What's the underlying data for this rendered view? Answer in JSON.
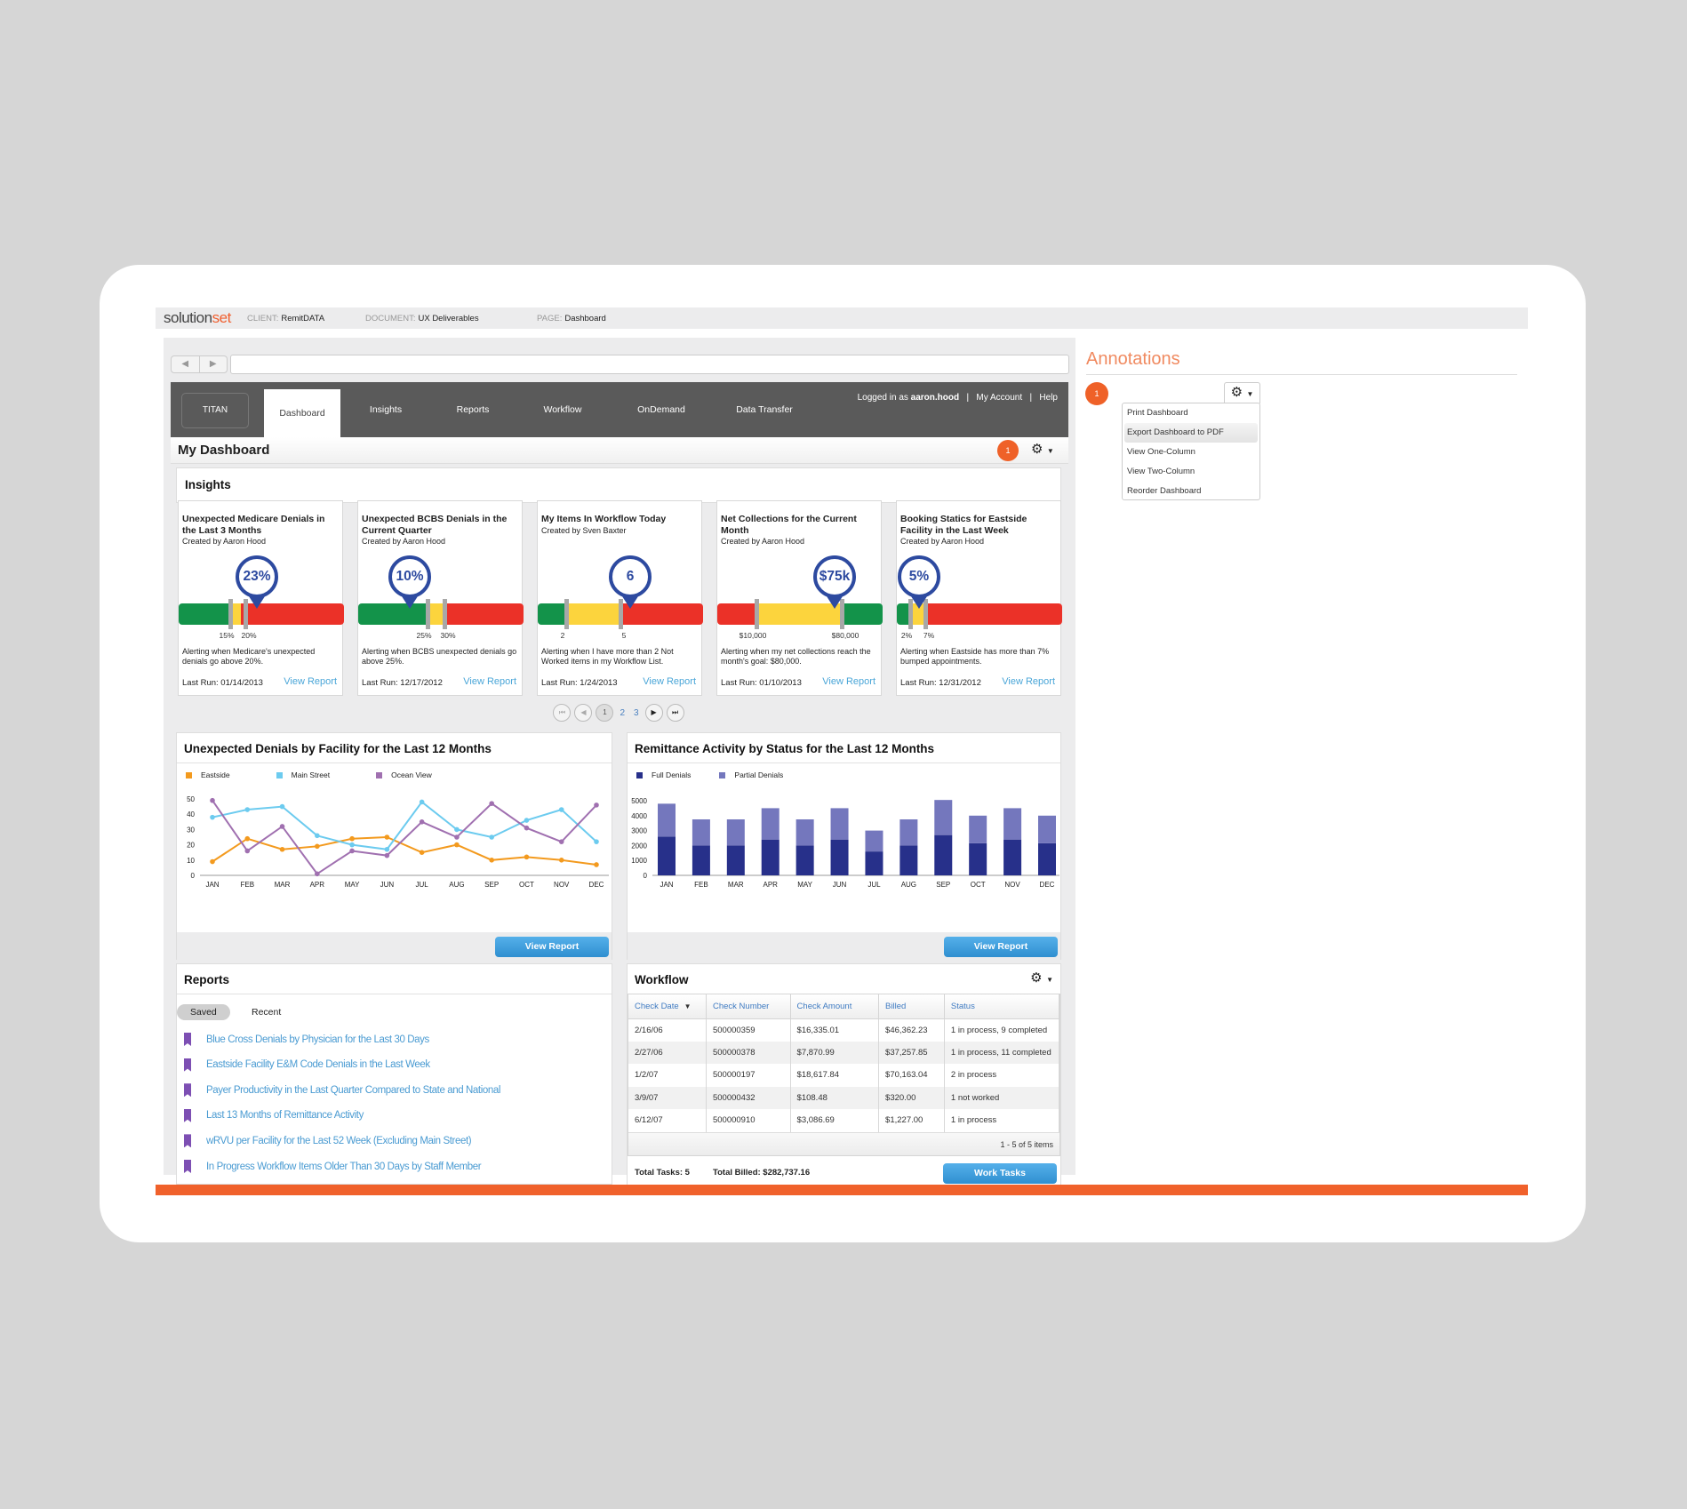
{
  "docbar": {
    "logo_a": "solution",
    "logo_b": "set",
    "client_label": "CLIENT:",
    "client": "RemitDATA",
    "document_label": "DOCUMENT:",
    "document": "UX Deliverables",
    "page_label": "PAGE:",
    "page": "Dashboard"
  },
  "nav": {
    "brand": "TITAN",
    "tabs": [
      "Dashboard",
      "Insights",
      "Reports",
      "Workflow",
      "OnDemand",
      "Data Transfer"
    ],
    "active": "Dashboard",
    "logged_in_prefix": "Logged in as",
    "user": "aaron.hood",
    "my_account": "My Account",
    "help": "Help",
    "sep": "|"
  },
  "dashboard": {
    "title": "My Dashboard",
    "annotation_badge": "1",
    "gear": "gear-icon"
  },
  "insights": {
    "title": "Insights",
    "cards": [
      {
        "title": "Unexpected Medicare Denials in the Last 3 Months",
        "creator": "Created by Aaron Hood",
        "value": "23%",
        "ticks": [
          "15%",
          "20%"
        ],
        "desc": "Alerting when Medicare's unexpected denials go above 20%.",
        "last_run": "Last Run: 01/14/2013",
        "link": "View Report"
      },
      {
        "title": "Unexpected BCBS Denials in the Current Quarter",
        "creator": "Created by Aaron Hood",
        "value": "10%",
        "ticks": [
          "25%",
          "30%"
        ],
        "desc": "Alerting when BCBS unexpected denials go above 25%.",
        "last_run": "Last Run: 12/17/2012",
        "link": "View Report"
      },
      {
        "title": "My Items In Workflow Today",
        "creator": "Created by Sven Baxter",
        "value": "6",
        "ticks": [
          "2",
          "5"
        ],
        "desc": "Alerting when I have more than 2 Not Worked items in my Workflow List.",
        "last_run": "Last Run: 1/24/2013",
        "link": "View Report"
      },
      {
        "title": "Net Collections for the Current Month",
        "creator": "Created by Aaron Hood",
        "value": "$75k",
        "ticks": [
          "$10,000",
          "$80,000"
        ],
        "desc": "Alerting when my net collections reach the month's goal: $80,000.",
        "last_run": "Last Run: 01/10/2013",
        "link": "View Report"
      },
      {
        "title": "Booking Statics for Eastside Facility in the Last Week",
        "creator": "Created by Aaron Hood",
        "value": "5%",
        "ticks": [
          "2%",
          "7%"
        ],
        "desc": "Alerting when Eastside has more than 7% bumped appointments.",
        "last_run": "Last Run: 12/31/2012",
        "link": "View Report"
      }
    ],
    "pager": {
      "current": "1",
      "pages": [
        "2",
        "3"
      ]
    }
  },
  "chart_data": [
    {
      "type": "line",
      "title": "Unexpected Denials by Facility for the Last 12 Months",
      "categories": [
        "JAN",
        "FEB",
        "MAR",
        "APR",
        "MAY",
        "JUN",
        "JUL",
        "AUG",
        "SEP",
        "OCT",
        "NOV",
        "DEC"
      ],
      "series": [
        {
          "name": "Eastside",
          "color": "#f39a1e",
          "values": [
            9,
            24,
            17,
            19,
            24,
            25,
            15,
            20,
            10,
            12,
            10,
            7
          ]
        },
        {
          "name": "Main Street",
          "color": "#6ccbef",
          "values": [
            38,
            43,
            45,
            26,
            20,
            17,
            48,
            30,
            25,
            36,
            43,
            22
          ]
        },
        {
          "name": "Ocean View",
          "color": "#a070b0",
          "values": [
            49,
            16,
            32,
            1,
            16,
            13,
            35,
            25,
            47,
            31,
            22,
            46
          ]
        }
      ],
      "yticks": [
        0,
        10,
        20,
        30,
        40,
        50
      ],
      "ylim": [
        0,
        50
      ],
      "legend": "top-left",
      "button": "View Report"
    },
    {
      "type": "bar",
      "stacked": true,
      "title": "Remittance Activity by Status for the Last 12 Months",
      "categories": [
        "JAN",
        "FEB",
        "MAR",
        "APR",
        "MAY",
        "JUN",
        "JUL",
        "AUG",
        "SEP",
        "OCT",
        "NOV",
        "DEC"
      ],
      "series": [
        {
          "name": "Full Denials",
          "color": "#27308a",
          "values": [
            2600,
            2000,
            2000,
            2400,
            2000,
            2400,
            1600,
            2000,
            2700,
            2150,
            2400,
            2150
          ]
        },
        {
          "name": "Partial Denials",
          "color": "#7477bd",
          "values": [
            2200,
            1750,
            1750,
            2100,
            1750,
            2100,
            1400,
            1750,
            2350,
            1850,
            2100,
            1850
          ]
        }
      ],
      "yticks": [
        0,
        1000,
        2000,
        3000,
        4000,
        5000
      ],
      "ylim": [
        0,
        5000
      ],
      "legend": "top-left",
      "button": "View Report"
    }
  ],
  "reports": {
    "title": "Reports",
    "tabs": [
      "Saved",
      "Recent"
    ],
    "items": [
      "Blue Cross Denials by Physician for the Last 30 Days",
      "Eastside Facility E&M Code Denials in the Last Week",
      "Payer Productivity in the Last Quarter Compared to State and National",
      "Last 13 Months of Remittance Activity",
      "wRVU per Facility for the Last 52 Week (Excluding Main Street)",
      "In Progress Workflow Items Older Than 30 Days by Staff Member"
    ]
  },
  "workflow": {
    "title": "Workflow",
    "columns": [
      "Check Date",
      "Check Number",
      "Check Amount",
      "Billed",
      "Status"
    ],
    "rows": [
      [
        "2/16/06",
        "500000359",
        "$16,335.01",
        "$46,362.23",
        "1 in process, 9 completed"
      ],
      [
        "2/27/06",
        "500000378",
        "$7,870.99",
        "$37,257.85",
        "1 in process, 11 completed"
      ],
      [
        "1/2/07",
        "500000197",
        "$18,617.84",
        "$70,163.04",
        "2 in process"
      ],
      [
        "3/9/07",
        "500000432",
        "$108.48",
        "$320.00",
        "1 not worked"
      ],
      [
        "6/12/07",
        "500000910",
        "$3,086.69",
        "$1,227.00",
        "1 in process"
      ]
    ],
    "count": "1 - 5 of 5 items",
    "total_tasks": "Total Tasks: 5",
    "total_billed": "Total Billed: $282,737.16",
    "button": "Work Tasks"
  },
  "annotations": {
    "title": "Annotations",
    "badge": "1",
    "menu": [
      "Print Dashboard",
      "Export Dashboard to PDF",
      "View One-Column",
      "View Two-Column",
      "Reorder Dashboard"
    ],
    "highlighted": "Export Dashboard to PDF"
  }
}
